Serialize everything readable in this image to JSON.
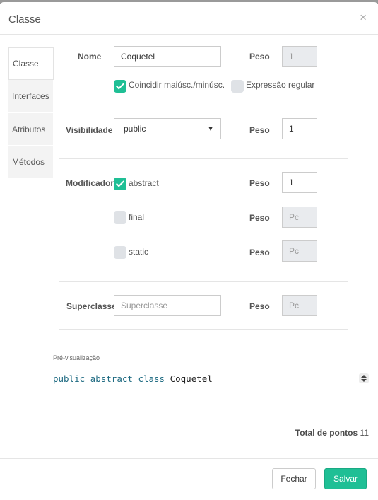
{
  "modal": {
    "title": "Classe",
    "close": "×"
  },
  "tabs": [
    {
      "label": "Classe",
      "active": true
    },
    {
      "label": "Interfaces",
      "active": false
    },
    {
      "label": "Atributos",
      "active": false
    },
    {
      "label": "Métodos",
      "active": false
    }
  ],
  "nome": {
    "label": "Nome",
    "value": "Coquetel",
    "peso_label": "Peso",
    "peso_value": "1",
    "match_case": {
      "label": "Coincidir maiúsc./minúsc.",
      "checked": true
    },
    "regex": {
      "label": "Expressão regular",
      "checked": false
    }
  },
  "visibilidade": {
    "label": "Visibilidade",
    "value": "public",
    "peso_label": "Peso",
    "peso_value": "1"
  },
  "modificador": {
    "label": "Modificador",
    "items": [
      {
        "label": "abstract",
        "checked": true,
        "peso_label": "Peso",
        "peso_value": "1",
        "peso_placeholder": ""
      },
      {
        "label": "final",
        "checked": false,
        "peso_label": "Peso",
        "peso_value": "",
        "peso_placeholder": "Pc"
      },
      {
        "label": "static",
        "checked": false,
        "peso_label": "Peso",
        "peso_value": "",
        "peso_placeholder": "Pc"
      }
    ]
  },
  "superclasse": {
    "label": "Superclasse",
    "placeholder": "Superclasse",
    "peso_label": "Peso",
    "peso_placeholder": "Pc"
  },
  "preview": {
    "label": "Pré-visualização",
    "tokens": [
      {
        "text": "public",
        "kind": "kw"
      },
      {
        "text": " ",
        "kind": "sp"
      },
      {
        "text": "abstract",
        "kind": "kw"
      },
      {
        "text": " ",
        "kind": "sp"
      },
      {
        "text": "class",
        "kind": "kw"
      },
      {
        "text": " ",
        "kind": "sp"
      },
      {
        "text": "Coquetel",
        "kind": "id"
      }
    ]
  },
  "total": {
    "label": "Total de pontos",
    "value": "11"
  },
  "buttons": {
    "close": "Fechar",
    "save": "Salvar"
  },
  "colors": {
    "accent": "#1fbf95",
    "code_keyword": "#1f6b82"
  }
}
